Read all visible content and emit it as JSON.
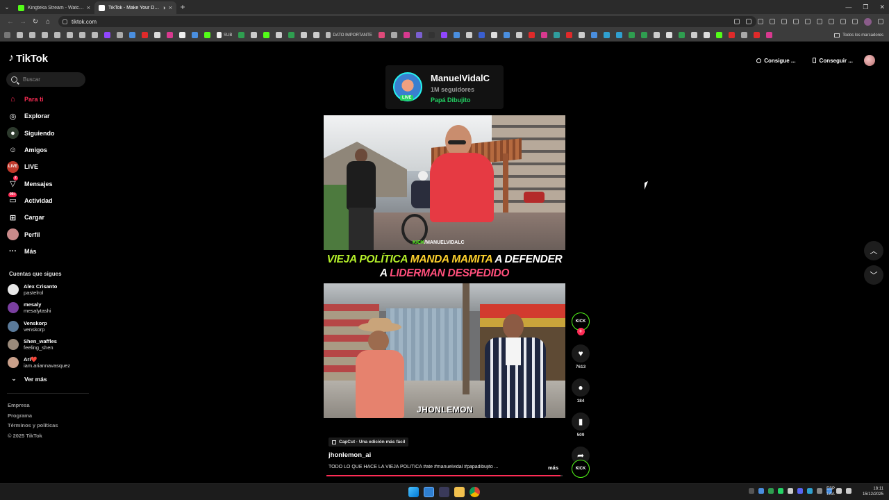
{
  "browser": {
    "tabs": [
      {
        "title": "Kingteka Stream - Watch Live o...",
        "favicon_color": "#53fc18",
        "active": false
      },
      {
        "title": "TikTok - Make Your Day",
        "favicon_color": "#ffffff",
        "active": true
      }
    ],
    "url": "tiktok.com",
    "bookmarks": {
      "labels": [
        "SUB",
        "DATO IMPORTANTE"
      ],
      "all_bookmarks_label": "Todos los marcadores"
    }
  },
  "sidebar": {
    "logo_text": "TikTok",
    "search_placeholder": "Buscar",
    "nav": [
      {
        "label": "Para ti",
        "icon": "home-icon",
        "active": true
      },
      {
        "label": "Explorar",
        "icon": "compass-icon"
      },
      {
        "label": "Siguiendo",
        "icon": "following-icon"
      },
      {
        "label": "Amigos",
        "icon": "friends-icon"
      },
      {
        "label": "LIVE",
        "icon": "live-icon"
      },
      {
        "label": "Mensajes",
        "icon": "messages-icon",
        "badge": "2"
      },
      {
        "label": "Actividad",
        "icon": "activity-icon",
        "badge": "99+"
      },
      {
        "label": "Cargar",
        "icon": "upload-icon"
      },
      {
        "label": "Perfil",
        "icon": "profile-icon"
      },
      {
        "label": "Más",
        "icon": "more-icon"
      }
    ],
    "following_title": "Cuentas que sigues",
    "following": [
      {
        "name": "Alex Crisanto",
        "username": "pastelrol",
        "color": "#e8e8e8"
      },
      {
        "name": "mesaly",
        "username": "mesalytashi",
        "color": "#7a3fa0"
      },
      {
        "name": "Venskorp",
        "username": "venskorp",
        "color": "#5a7a9a"
      },
      {
        "name": "Shen_waffles",
        "username": "feeling_shen",
        "color": "#9a8a7a"
      },
      {
        "name": "Ari❤️",
        "username": "iam.ariannavasquez",
        "color": "#c9a08a"
      }
    ],
    "see_more": "Ver más",
    "footer": [
      "Empresa",
      "Programa",
      "Términos y políticas",
      "© 2025 TikTok"
    ]
  },
  "header_buttons": {
    "get_coins": "Consigue ...",
    "get_app": "Conseguir ..."
  },
  "live_card": {
    "name": "ManuelVidalC",
    "followers": "1M seguidores",
    "nickname": "Papá Dibujito",
    "live_tag": "LIVE"
  },
  "video": {
    "top_watermark_prefix": "KICK",
    "top_watermark_handle": "/MANUELVIDALC",
    "title_words": {
      "w1": "VIEJA POLÍTICA",
      "w2": "MANDA MAMITA",
      "w3": "A DEFENDER",
      "w4": "A",
      "w5": "LIDERMAN DESPEDIDO"
    },
    "bottom_watermark": "JHONLEMON",
    "capcut_label": "CapCut · Una edición más fácil",
    "author": "jhonlemon_ai",
    "caption": "TODO LO QUE HACE LA VIEJA POLÍTICA #ate #manuelvidal #papadibujito ...",
    "more_label": "más",
    "progress": 0.99
  },
  "actions": {
    "creator_label": "KICK",
    "likes": "7613",
    "comments": "184",
    "saves": "509",
    "shares": "149",
    "sound_label": "KICK"
  },
  "taskbar": {
    "language": [
      "ESP",
      "LAA"
    ],
    "time": "18:11",
    "date": "15/12/2025"
  },
  "colors": {
    "tiktok_red": "#fe2c55",
    "kick_green": "#53fc18",
    "live_green": "#22d163"
  }
}
